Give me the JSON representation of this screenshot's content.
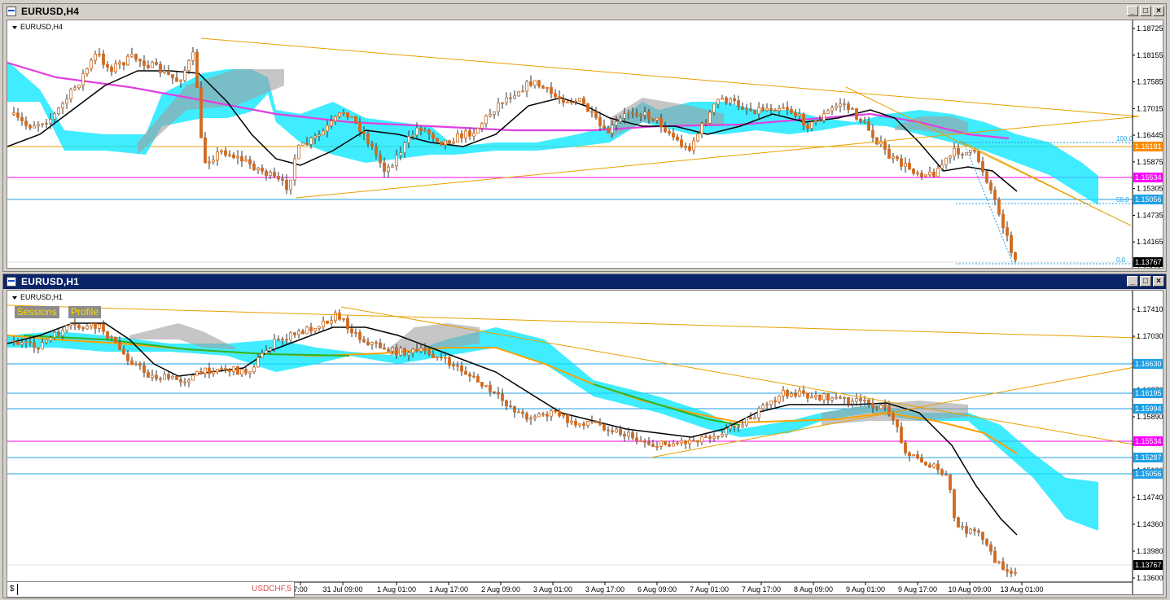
{
  "windows": [
    {
      "title": "EURUSD,H4",
      "chart_label": "EURUSD,H4",
      "price_labels": [
        "1.18725",
        "1.18155",
        "1.17585",
        "1.17015",
        "1.16445",
        "1.15875",
        "1.15305",
        "1.14735",
        "1.14165",
        "1.13595"
      ],
      "tagged_prices": [
        {
          "value": "1.16181",
          "color": "#ff8c00"
        },
        {
          "value": "1.15534",
          "color": "#ff00ff"
        },
        {
          "value": "1.15056",
          "color": "#1ea0e6"
        },
        {
          "value": "1.13767",
          "color": "#000000"
        }
      ],
      "fib_labels": [
        "100.0",
        "50.0",
        "0.0"
      ]
    },
    {
      "title": "EURUSD,H1",
      "chart_label": "EURUSD,H1",
      "indicator_buttons": [
        "Sessions",
        "Profile"
      ],
      "price_labels": [
        "1.17410",
        "1.17030",
        "1.16630",
        "1.16270",
        "1.15890",
        "1.15510",
        "1.15120",
        "1.14740",
        "1.14360",
        "1.13980",
        "1.13600"
      ],
      "tagged_prices": [
        {
          "value": "1.16630",
          "color": "#1ea0e6"
        },
        {
          "value": "1.16195",
          "color": "#1ea0e6"
        },
        {
          "value": "1.15994",
          "color": "#1ea0e6"
        },
        {
          "value": "1.15534",
          "color": "#ff00ff"
        },
        {
          "value": "1.15287",
          "color": "#1ea0e6"
        },
        {
          "value": "1.15056",
          "color": "#1ea0e6"
        },
        {
          "value": "1.13767",
          "color": "#000000"
        }
      ],
      "time_labels": [
        "7:00",
        "31 Jul 09:00",
        "1 Aug 01:00",
        "1 Aug 17:00",
        "2 Aug 09:00",
        "3 Aug 01:00",
        "3 Aug 17:00",
        "6 Aug 09:00",
        "7 Aug 01:00",
        "7 Aug 17:00",
        "8 Aug 09:00",
        "9 Aug 01:00",
        "9 Aug 17:00",
        "10 Aug 09:00",
        "13 Aug 01:00"
      ]
    }
  ],
  "bottom_bar": {
    "prefix": "$",
    "tab": "USDCHF,5"
  }
}
